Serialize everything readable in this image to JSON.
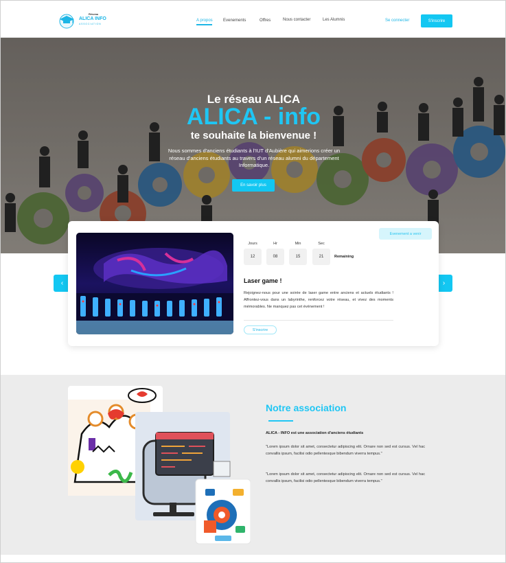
{
  "nav": {
    "logo_top": "Réseau",
    "logo_name": "ALICA INFO",
    "logo_sub": "ASSOCIATION",
    "links": [
      {
        "label": "A propos",
        "active": true
      },
      {
        "label": "Evenements",
        "active": false
      },
      {
        "label": "Offres",
        "active": false
      },
      {
        "label": "Nous contacter",
        "active": false
      },
      {
        "label": "Les Alumnis",
        "active": false
      }
    ],
    "login_label": "Se connecter",
    "signup_label": "S'inscrire"
  },
  "hero": {
    "title1": "Le réseau ALICA",
    "title2": "ALICA - info",
    "title3": "te souhaite la bienvenue !",
    "text": "Nous sommes d'anciens étudiants à l'IUT d'Aubière qui aimerions créer un réseau d'anciens étudiants au travers d'un réseau alumni du département Informatique.",
    "button_label": "En savoir plus"
  },
  "event": {
    "badge": "Evenement a venir",
    "countdown": [
      {
        "label": "Jours",
        "value": "12"
      },
      {
        "label": "Hr",
        "value": "08"
      },
      {
        "label": "Min",
        "value": "15"
      },
      {
        "label": "Sec",
        "value": "21"
      }
    ],
    "remaining_label": "Remaining",
    "title": "Laser game !",
    "description": "Rejoignez-nous pour une soirée de laser game entre anciens et actuels étudiants ! Affrontez-vous dans un labyrinthe, renforcez votre réseau, et vivez des moments mémorables. Ne manquez pas cet événement !",
    "button_label": "S'inscrire",
    "prev_icon": "‹",
    "next_icon": "›"
  },
  "association": {
    "title": "Notre association",
    "lead": "ALICA - INFO est une association d'anciens étudiants",
    "paragraphs": [
      "\"Lorem ipsum dolor sit amet, consectetur adipiscing elit. Ornare non sed est cursus. Vel hac convallis ipsum, facilisi odio pellentesque bibendum viverra tempus.\"",
      "\"Lorem ipsum dolor sit amet, consectetur adipiscing elit. Ornare non sed est cursus. Vel hac convallis ipsum, facilisi odio pellentesque bibendum viverra tempus.\""
    ]
  },
  "colors": {
    "accent": "#13c7f2",
    "hero_title_accent": "#1fc6f4",
    "section_bg": "#ececec"
  }
}
